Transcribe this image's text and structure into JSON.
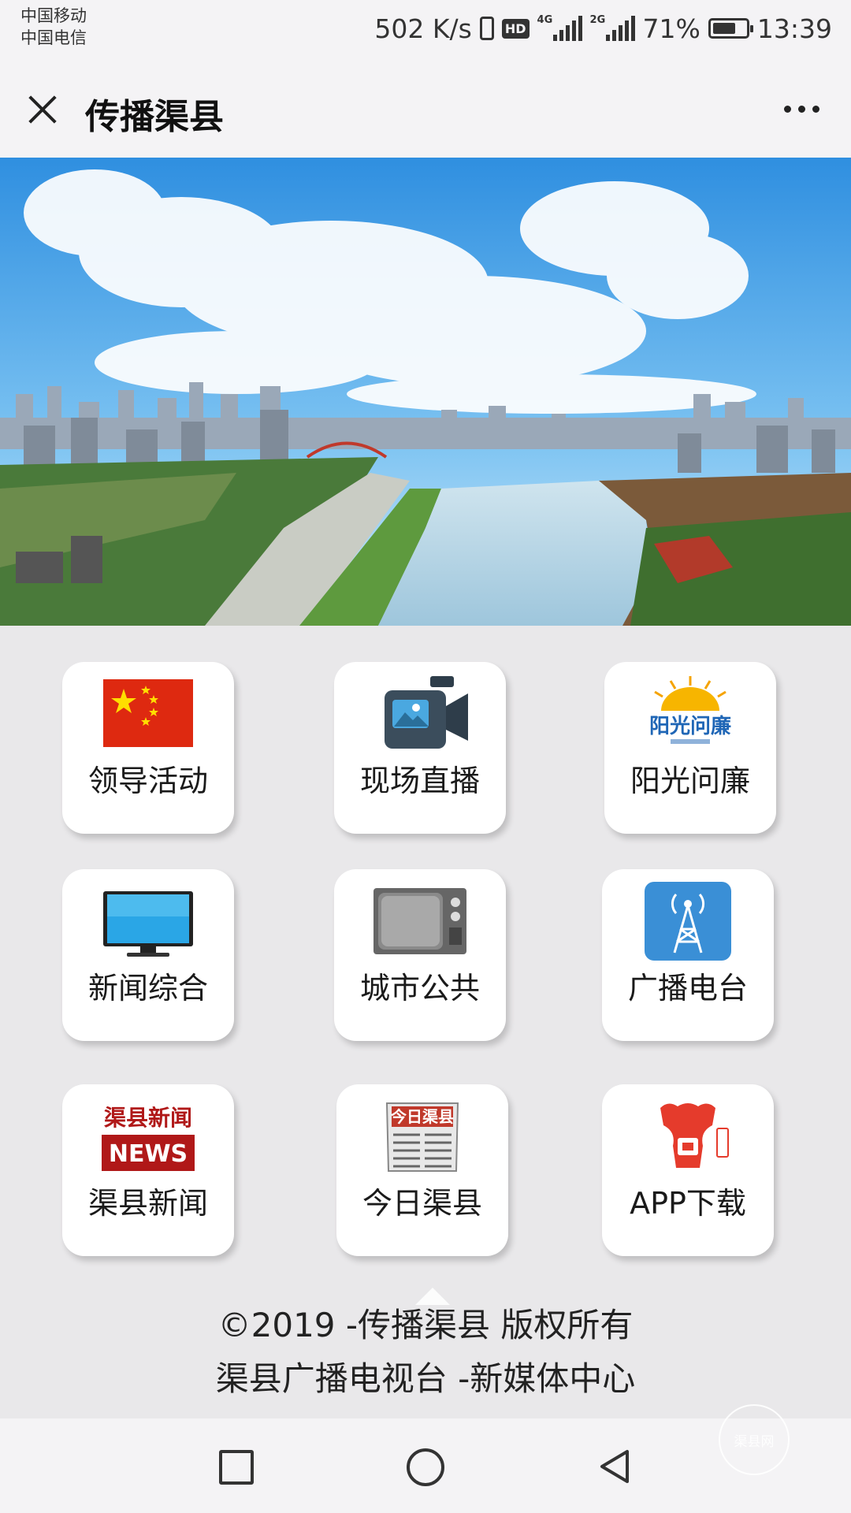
{
  "status_bar": {
    "carrier_1": "中国移动",
    "carrier_2": "中国电信",
    "speed": "502 K/s",
    "hd": "HD",
    "net_1": "4G",
    "net_2": "2G",
    "battery": "71%",
    "battery_level": 0.71,
    "time": "13:39"
  },
  "title_bar": {
    "title": "传播渠县",
    "close_icon": "close-icon",
    "more_icon": "more-dots-icon"
  },
  "banner": {
    "description_icon": "city-river-panorama"
  },
  "tiles": [
    {
      "label": "领导活动",
      "icon": "china-flag-icon"
    },
    {
      "label": "现场直播",
      "icon": "video-camera-icon"
    },
    {
      "label": "阳光问廉",
      "icon": "sunshine-logo-icon",
      "icon_text": "阳光问廉"
    },
    {
      "label": "新闻综合",
      "icon": "flat-tv-icon"
    },
    {
      "label": "城市公共",
      "icon": "retro-tv-icon"
    },
    {
      "label": "广播电台",
      "icon": "radio-tower-icon"
    },
    {
      "label": "渠县新闻",
      "icon": "news-logo-icon",
      "icon_text_1": "渠县新闻",
      "icon_text_2": "NEWS"
    },
    {
      "label": "今日渠县",
      "icon": "newspaper-icon",
      "icon_text": "今日渠县"
    },
    {
      "label": "APP下载",
      "icon": "app-logo-icon"
    }
  ],
  "footer": {
    "line_1": "©2019 -传播渠县 版权所有",
    "line_2": "渠县广播电视台 -新媒体中心"
  },
  "nav_bar": {
    "recent_icon": "recent-apps-icon",
    "home_icon": "home-icon",
    "back_icon": "back-icon"
  },
  "watermark": {
    "text": "渠县网"
  },
  "colors": {
    "background": "#e9e8ea",
    "bar": "#f4f3f5",
    "tile": "#ffffff",
    "flag_red": "#de2910",
    "radio_blue": "#3a8fd6"
  }
}
